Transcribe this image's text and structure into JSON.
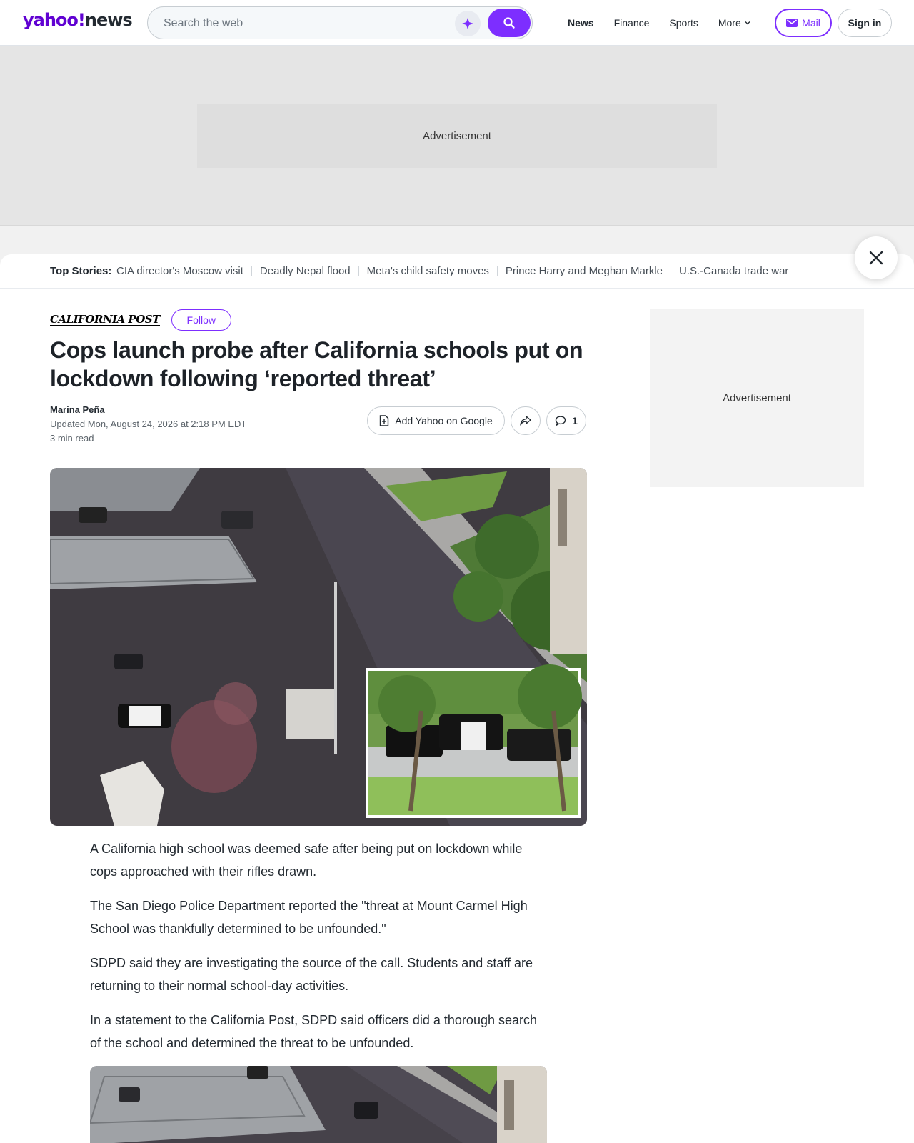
{
  "header": {
    "logo_brand": "yahoo!",
    "logo_section": "news",
    "search_placeholder": "Search the web",
    "nav": [
      "News",
      "Finance",
      "Sports",
      "More"
    ],
    "mail_label": "Mail",
    "signin_label": "Sign in",
    "accent_color": "#7d2eff"
  },
  "ads": {
    "top_label": "Advertisement",
    "side_label": "Advertisement"
  },
  "top_stories": {
    "label": "Top Stories:",
    "items": [
      "CIA director's Moscow visit",
      "Deadly Nepal flood",
      "Meta's child safety moves",
      "Prince Harry and Meghan Markle",
      "U.S.-Canada trade war"
    ]
  },
  "article": {
    "publisher": "California Post",
    "follow_label": "Follow",
    "headline": "Cops launch probe after California schools put on lockdown following ‘reported threat’",
    "author": "Marina Peña",
    "updated": "Updated Mon, August 24, 2026 at 2:18 PM EDT",
    "read_time": "3 min read",
    "actions": {
      "google_label": "Add Yahoo on Google",
      "comment_count": "1"
    },
    "paragraphs": [
      "A California high school was deemed safe after being put on lockdown while cops approached with their rifles drawn.",
      "The San Diego Police Department reported the \"threat at Mount Carmel High School was thankfully determined to be unfounded.\"",
      "SDPD said they are investigating the source of the call. Students and staff are returning to their normal school-day activities.",
      "In a statement to the California Post, SDPD said officers did a thorough search of the school and determined the threat to be unfounded."
    ]
  },
  "icons": {
    "search": "search-icon",
    "ai": "sparkle-icon",
    "mail": "mail-icon",
    "close": "close-icon",
    "share": "share-icon",
    "comment": "comment-icon",
    "doc": "document-icon"
  }
}
